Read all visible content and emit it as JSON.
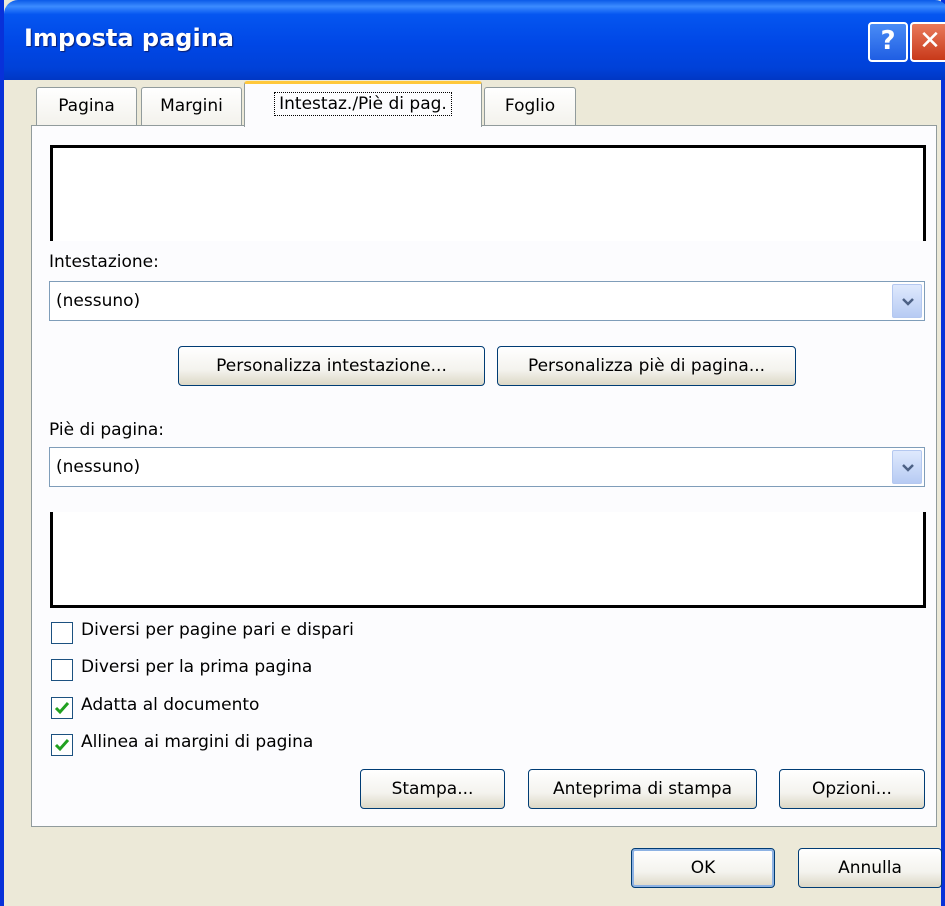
{
  "window": {
    "title": "Imposta pagina",
    "help_glyph": "?",
    "close_glyph": "✕"
  },
  "tabs": [
    {
      "label": "Pagina"
    },
    {
      "label": "Margini"
    },
    {
      "label": "Intestaz./Piè di pag.",
      "active": true
    },
    {
      "label": "Foglio"
    }
  ],
  "header": {
    "label": "Intestazione:",
    "value": "(nessuno)",
    "custom_button": "Personalizza intestazione..."
  },
  "footer": {
    "label": "Piè di pagina:",
    "value": "(nessuno)",
    "custom_button": "Personalizza piè di pagina..."
  },
  "options": [
    {
      "label": "Diversi per pagine pari e dispari",
      "checked": false
    },
    {
      "label": "Diversi per la prima pagina",
      "checked": false
    },
    {
      "label": "Adatta al documento",
      "checked": true
    },
    {
      "label": "Allinea ai margini di pagina",
      "checked": true
    }
  ],
  "panel_buttons": {
    "print": "Stampa...",
    "preview": "Anteprima di stampa",
    "options": "Opzioni..."
  },
  "dialog_buttons": {
    "ok": "OK",
    "cancel": "Annulla"
  },
  "colors": {
    "titlebar": "#0047e6",
    "dialog_bg": "#ece9d8",
    "tab_highlight": "#ffc83c",
    "checkmark": "#21a121"
  },
  "icons": {
    "combo_arrow": "chevron-down-icon",
    "check": "checkmark-icon"
  }
}
